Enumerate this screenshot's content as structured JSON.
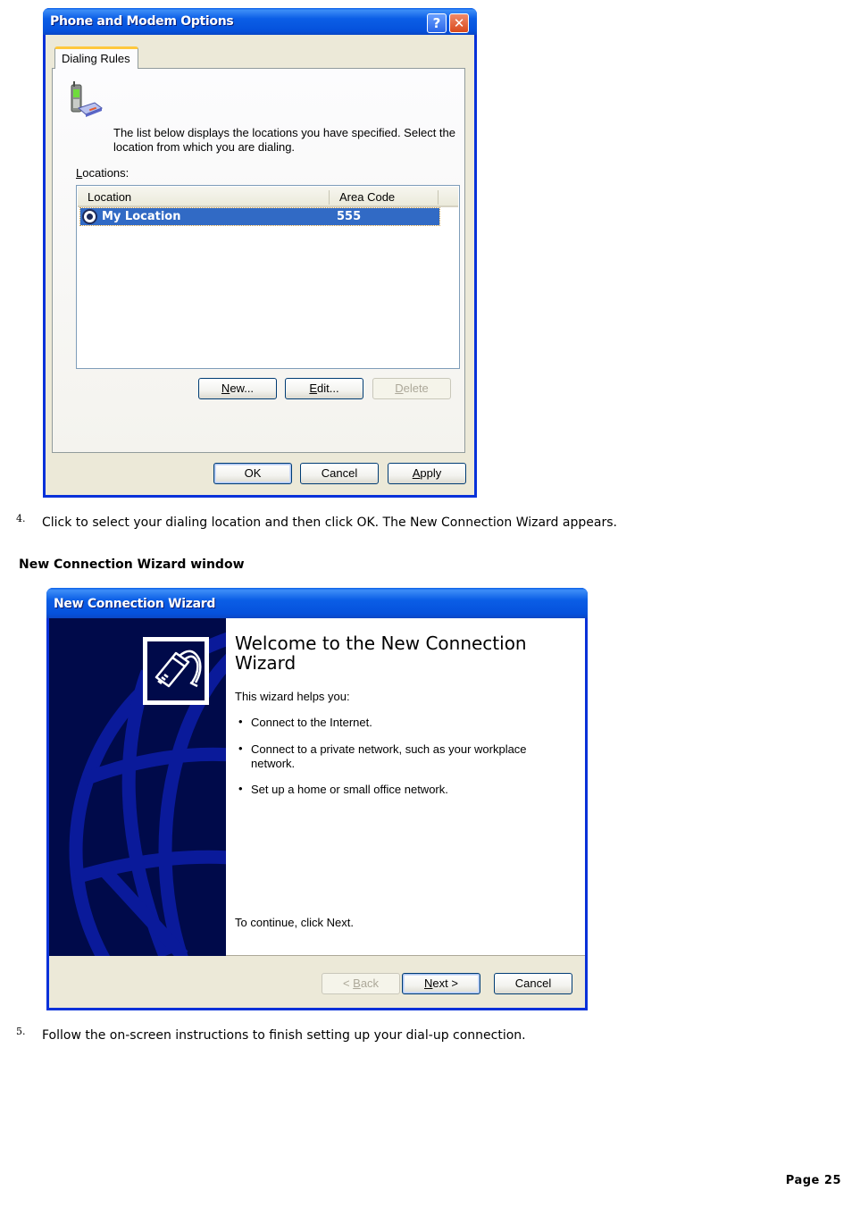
{
  "phone_modem_dialog": {
    "title": "Phone and Modem Options",
    "help_button": "?",
    "close_button": "✕",
    "tab_label": "Dialing Rules",
    "description": "The list below displays the locations you have specified. Select the location from which you are dialing.",
    "locations_label_accel": "L",
    "locations_label_rest": "ocations:",
    "list_columns": [
      "Location",
      "Area Code"
    ],
    "list_rows": [
      {
        "location": "My Location",
        "area_code": "555",
        "selected": true,
        "icon": "radio-selected-icon"
      }
    ],
    "buttons": {
      "new_accel": "N",
      "new_rest": "ew...",
      "edit_accel": "E",
      "edit_rest": "dit...",
      "delete_accel": "D",
      "delete_rest": "elete",
      "ok": "OK",
      "cancel": "Cancel",
      "apply_accel": "A",
      "apply_rest": "pply"
    },
    "header_icon": "phone-modem-icon"
  },
  "steps": [
    {
      "number": "4.",
      "text": "Click to select your dialing location and then click OK. The New Connection Wizard appears."
    },
    {
      "number": "5.",
      "text": "Follow the on-screen instructions to finish setting up your dial-up connection."
    }
  ],
  "section_heading": "New Connection Wizard window",
  "wizard": {
    "title": "New Connection Wizard",
    "welcome_title": "Welcome to the New Connection Wizard",
    "intro": "This wizard helps you:",
    "bullets": [
      "Connect to the Internet.",
      "Connect to a private network, such as your workplace network.",
      "Set up a home or small office network."
    ],
    "continue_text": "To continue, click Next.",
    "buttons": {
      "back_prefix": "< ",
      "back_accel": "B",
      "back_rest": "ack",
      "next_accel": "N",
      "next_rest": "ext >",
      "cancel": "Cancel"
    },
    "side_icon": "network-cable-icon",
    "side_art": "globe-graphic"
  },
  "page_label": "Page 25",
  "colors": {
    "xp_title_blue": "#0551dc",
    "selection_blue": "#316ac5",
    "wizard_side_navy": "#000a4a",
    "dialog_face": "#ece9d8"
  }
}
